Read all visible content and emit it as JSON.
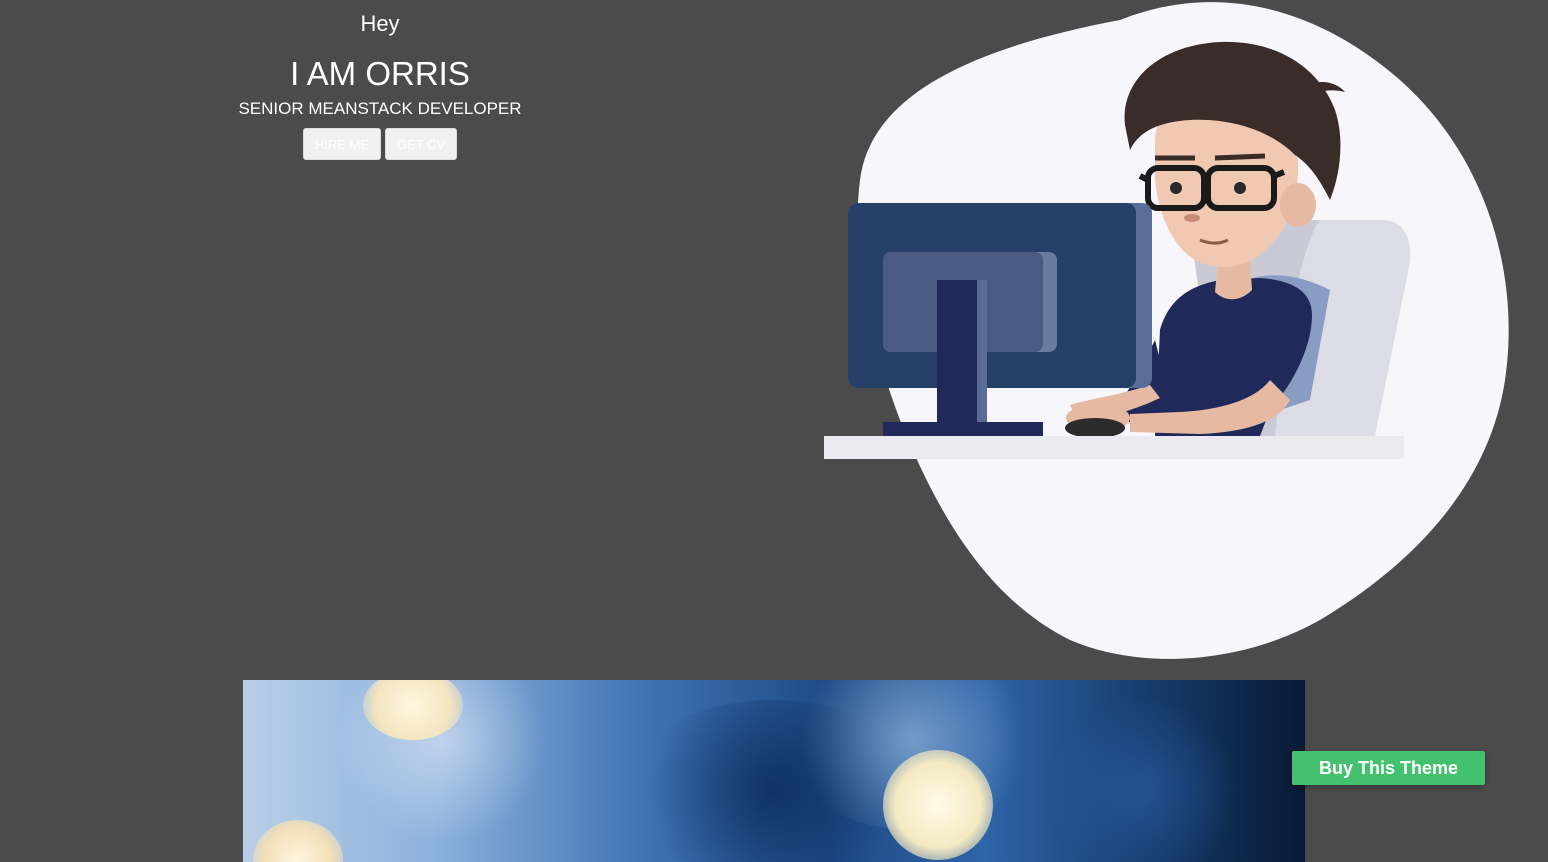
{
  "hero": {
    "greeting": "Hey",
    "name": "I AM ORRIS",
    "role": "SENIOR MEANSTACK DEVELOPER",
    "buttons": {
      "hire_label": "HIRE ME",
      "cv_label": "GET CV"
    }
  },
  "illustration": {
    "icon": "developer-at-computer-illustration"
  },
  "banner": {
    "icon": "bokeh-photo-banner"
  },
  "cta": {
    "buy_label": "Buy This Theme"
  },
  "colors": {
    "background": "#4b4b4b",
    "blob": "#f6f6fb",
    "accent_green": "#44c16f",
    "monitor": "#27406a",
    "shirt": "#1f2a5a"
  }
}
